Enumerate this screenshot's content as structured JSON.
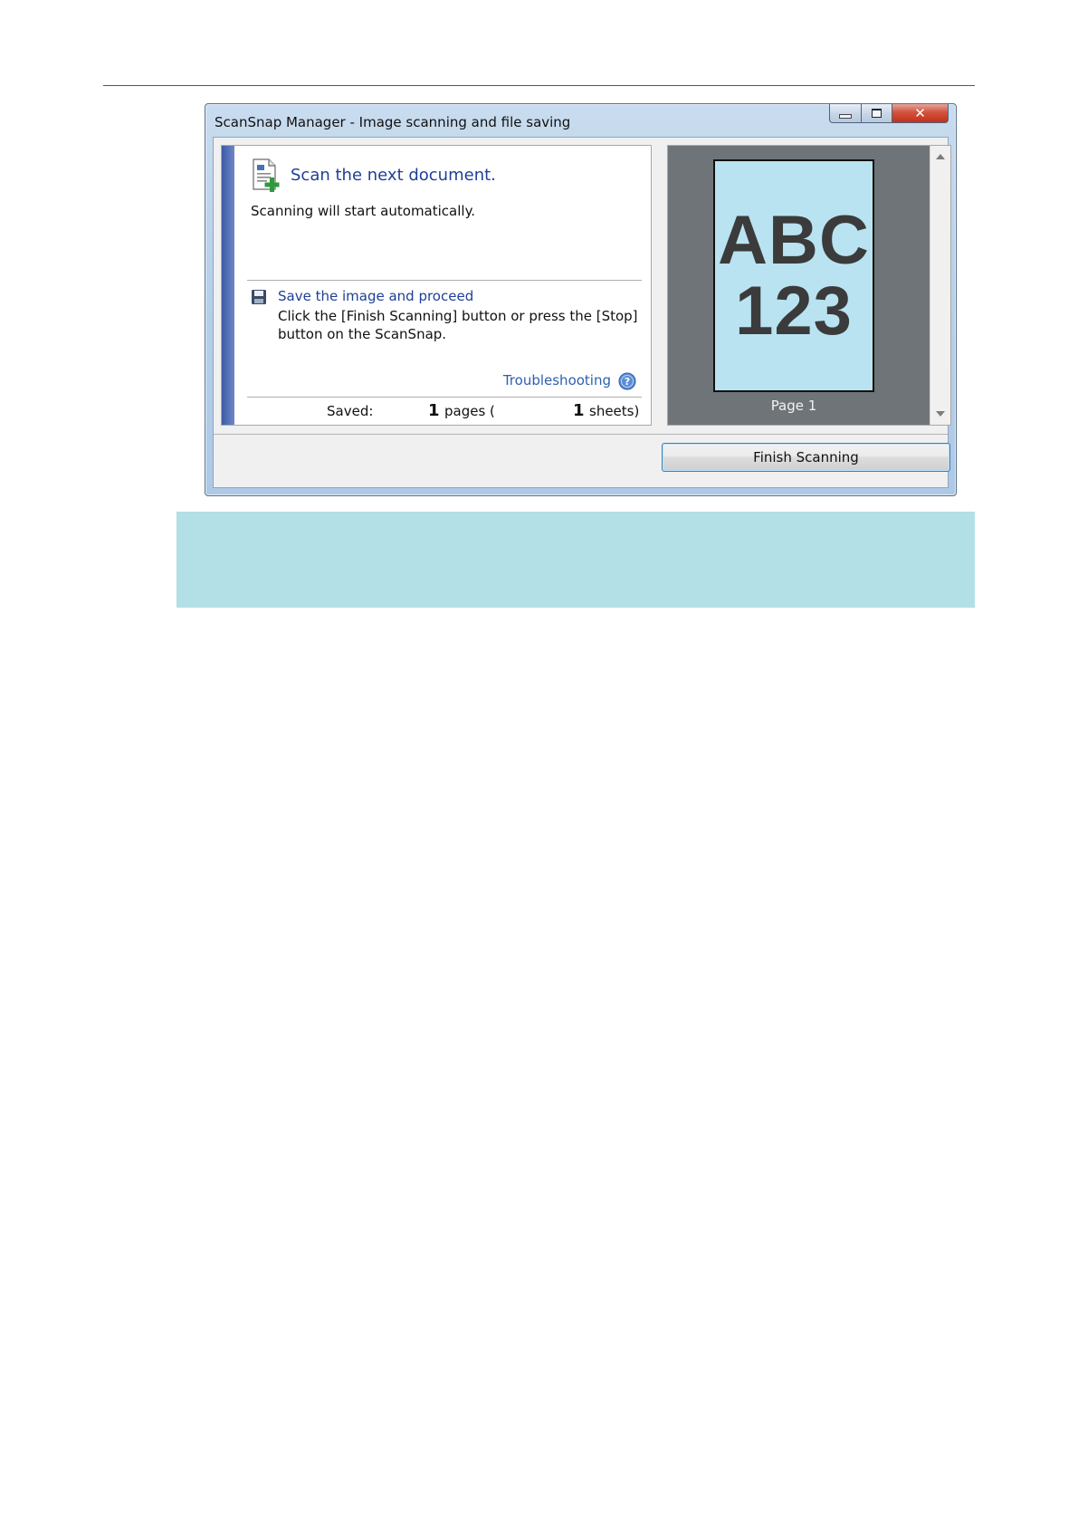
{
  "window": {
    "title": "ScanSnap Manager - Image scanning and file saving",
    "close_glyph": "✕"
  },
  "info": {
    "heading": "Scan the next document.",
    "subtext": "Scanning will start automatically.",
    "save_title": "Save the image and proceed",
    "save_desc": "Click the [Finish Scanning] button or press the [Stop] button on the ScanSnap.",
    "troubleshooting": "Troubleshooting",
    "saved_label": "Saved:",
    "pages_count": "1",
    "pages_label": "pages (",
    "sheets_count": "1",
    "sheets_label": "sheets)"
  },
  "preview": {
    "thumb_line1": "ABC",
    "thumb_line2": "123",
    "page_label": "Page 1"
  },
  "footer": {
    "finish_button": "Finish Scanning"
  },
  "colors": {
    "accent_blue": "#1f3f98",
    "link_blue": "#2e5fb0",
    "preview_bg": "#6f7478",
    "thumb_bg": "#b9e3f0",
    "note_band": "#b2e0e6"
  },
  "icons": {
    "scan": "scan-document-add-icon",
    "save": "floppy-disk-icon",
    "help": "help-question-icon"
  }
}
